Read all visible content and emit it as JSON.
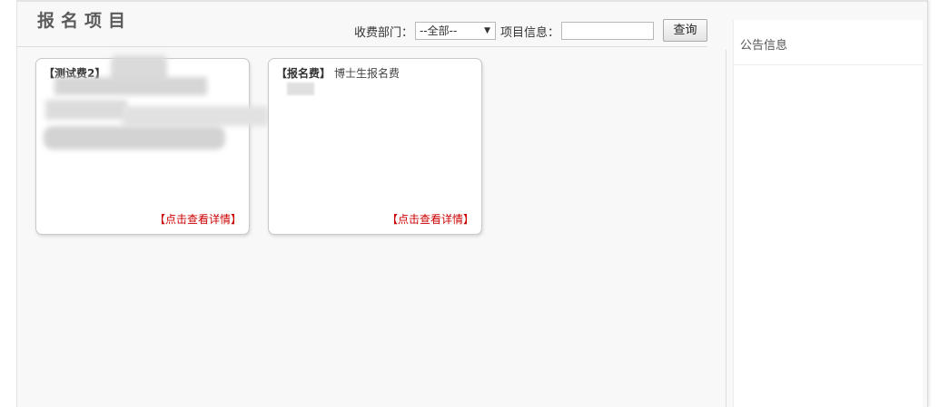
{
  "page_title": "报名项目",
  "filters": {
    "dept_label": "收费部门：",
    "dept_selected": "--全部--",
    "info_label": "项目信息：",
    "info_value": "",
    "query_button": "查询"
  },
  "projects": [
    {
      "type": "【测试费2】",
      "name": "",
      "link": "【点击查看详情】"
    },
    {
      "type": "【报名费】",
      "name": "博士生报名费",
      "link": "【点击查看详情】"
    }
  ],
  "sidebar": {
    "title": "公告信息"
  }
}
